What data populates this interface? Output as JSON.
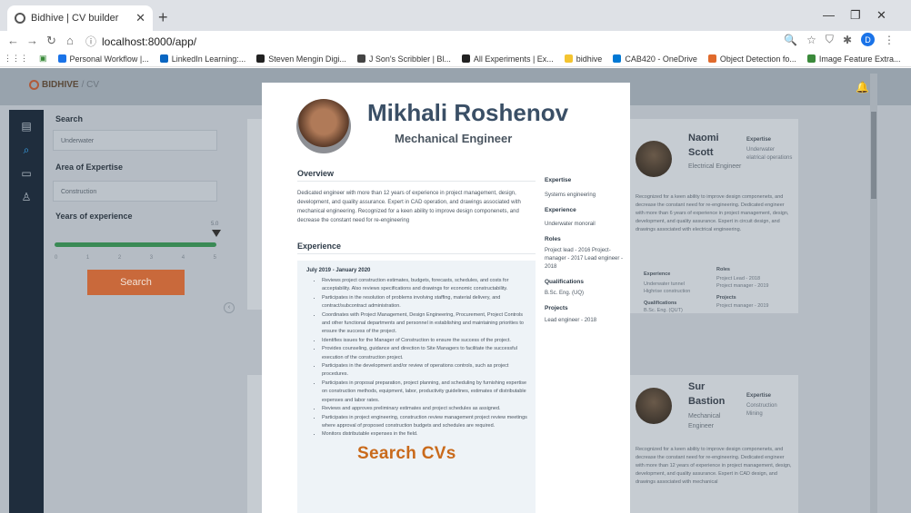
{
  "browser": {
    "tab_title": "Bidhive | CV builder",
    "url": "localhost:8000/app/",
    "profile_initial": "D",
    "bookmarks": [
      {
        "label": "Personal Workflow |...",
        "color": "#1a73e8"
      },
      {
        "label": "LinkedIn Learning:...",
        "color": "#0a66c2"
      },
      {
        "label": "Steven Mengin Digi...",
        "color": "#222222"
      },
      {
        "label": "J Son's Scribbler | Bl...",
        "color": "#444444"
      },
      {
        "label": "All Experiments | Ex...",
        "color": "#222222"
      },
      {
        "label": "bidhive",
        "color": "#f4c430"
      },
      {
        "label": "CAB420 - OneDrive",
        "color": "#0078d4"
      },
      {
        "label": "Object Detection fo...",
        "color": "#e06a2c"
      },
      {
        "label": "Image Feature Extra...",
        "color": "#3b8a3b"
      }
    ]
  },
  "app": {
    "logo": "BIDHIVE",
    "logo_sub": "/ CV",
    "sidebar_icons": [
      "document-icon",
      "search-icon",
      "window-icon",
      "user-icon"
    ],
    "search": {
      "label": "Search",
      "value": "Underwater",
      "expertise_label": "Area of Expertise",
      "expertise_value": "Construction",
      "years_label": "Years of experience",
      "years_value": "5.0",
      "ticks": [
        "0",
        "1",
        "2",
        "3",
        "4",
        "5"
      ],
      "years_fraction": 1.0,
      "button": "Search"
    }
  },
  "cv": {
    "name": "Mikhali Roshenov",
    "title": "Mechanical Engineer",
    "overview_heading": "Overview",
    "overview": "Dedicated engineer with more than 12 years of experience in project management, design, development, and quality assurance. Expert in CAD operation, and drawings associated with mechanical engineering. Recognized for a keen ability to improve design componenets, and decrease the constant need for re-engineering",
    "experience_heading": "Experience",
    "exp_date": "July 2019 - January 2020",
    "exp_items": [
      "Reviews project construction estimates, budgets, forecasts, schedules, and costs for acceptability. Also reviews specifications and drawings for economic constructability.",
      "Participates in the resolution of problems involving staffing, material delivery, and contract/subcontract administration.",
      "Coordinates with Project Management, Design Engineering, Procurement, Project Controls and other functional departments and personnel in establishing and maintaining priorities to ensure the success of the project.",
      "Identifies issues for the Manager of Construction to ensure the success of the project.",
      "Provides counseling, guidance and direction to Site Managers to facilitate the successful execution of the construction project.",
      "Participates in the development and/or review of operations controls, such as project procedures.",
      "Participates in proposal preparation, project planning, and scheduling by furnishing expertise on construction methods, equipment, labor, productivity guidelines, estimates of distributable expenses and labor rates.",
      "Reviews and approves preliminary estimates and project schedules as assigned.",
      "Participates in project engineering, construction review management project review meetings where approval of proposed construction budgets and schedules are required.",
      "Monitors distributable expenses in the field."
    ],
    "side": {
      "expertise_h": "Expertise",
      "expertise_v": "Systems engineering",
      "experience_h": "Experience",
      "experience_v": "Underwater monorail",
      "roles_h": "Roles",
      "roles_v": "Project lead - 2016 Project-manager - 2017 Lead engineer - 2018",
      "qual_h": "Qualifications",
      "qual_v": "B.Sc. Eng. (UQ)",
      "projects_h": "Projects",
      "projects_v": "Lead engineer - 2018"
    }
  },
  "cards": [
    {
      "first": "Naomi",
      "last": "Scott",
      "job": "Electrical Engineer",
      "expertise_h": "Expertise",
      "expertise_v": "Underwater elatrical operations",
      "desc": "Recognized for a keen ability to improve design componenets, and decrease the constant need for re-engineering. Dedicated engineer with more than 6 years of experience in project management, design, development, and quality assurance. Expert in circuit design, and drawings associated with electrical engineering.",
      "experience_h": "Experience",
      "experience_v": "Underwater tunnel Highrise construction",
      "roles_h": "Roles",
      "roles_v": "Project Lead - 2018 Project manager - 2019",
      "qual_h": "Qualifications",
      "qual_v": "B.Sc. Eng. (QUT)",
      "projects_h": "Projects",
      "projects_v": "Project manager - 2019"
    },
    {
      "first": "Sur",
      "last": "Bastion",
      "job": "Mechanical Engineer",
      "expertise_h": "Expertise",
      "expertise_v": "Construction Mining",
      "desc": "Recognized for a keen ability to improve design componenets, and decrease the constant need for re-engineering. Dedicated engineer with more than 12 years of experience in project management, design, development, and quality assurance. Expert in CAD design, and drawings associated with mechanical"
    }
  ],
  "caption": "Search CVs"
}
